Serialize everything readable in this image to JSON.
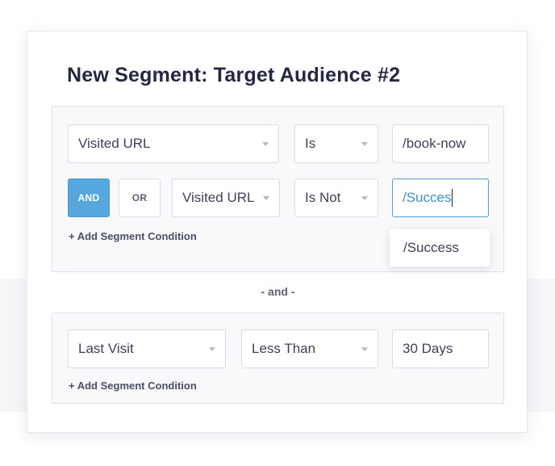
{
  "segment": {
    "title": "New Segment: Target Audience #2"
  },
  "group1": {
    "row1": {
      "field": "Visited URL",
      "operator": "Is",
      "value": "/book-now"
    },
    "row2": {
      "and_label": "AND",
      "or_label": "OR",
      "field": "Visited URL",
      "operator": "Is Not",
      "value": "/Succes"
    },
    "suggestion": "/Success",
    "add_condition": "+ Add Segment Condition"
  },
  "connector": "- and -",
  "group2": {
    "row1": {
      "field": "Last Visit",
      "operator": "Less Than",
      "value": "30 Days"
    },
    "add_condition": "+ Add Segment Condition"
  },
  "colors": {
    "accent": "#57a7df",
    "focus_border": "#4a9fdc",
    "title": "#232845"
  }
}
